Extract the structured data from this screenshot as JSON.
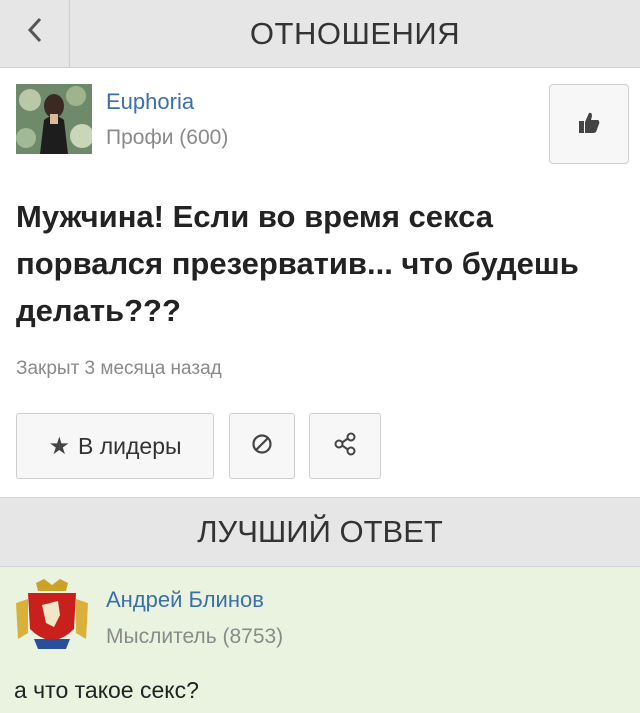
{
  "header": {
    "title": "ОТНОШЕНИЯ",
    "back_icon": "chevron-left-icon"
  },
  "author": {
    "name": "Euphoria",
    "rank": "Профи (600)"
  },
  "question": {
    "text": "Мужчина! Если во время секса порвался презерватив... что будешь делать???",
    "status": "Закрыт 3 месяца назад"
  },
  "actions": {
    "leaders_label": "В лидеры",
    "leaders_icon": "star-icon",
    "block_icon": "block-icon",
    "share_icon": "share-icon",
    "like_icon": "thumbs-up-icon"
  },
  "best_answer": {
    "section_title": "ЛУЧШИЙ ОТВЕТ",
    "name": "Андрей Блинов",
    "rank": "Мыслитель (8753)",
    "text": "а что такое секс?",
    "background": "#e9f3df"
  },
  "colors": {
    "link": "#3b6fa9",
    "header_bg": "#e6e6e6"
  }
}
